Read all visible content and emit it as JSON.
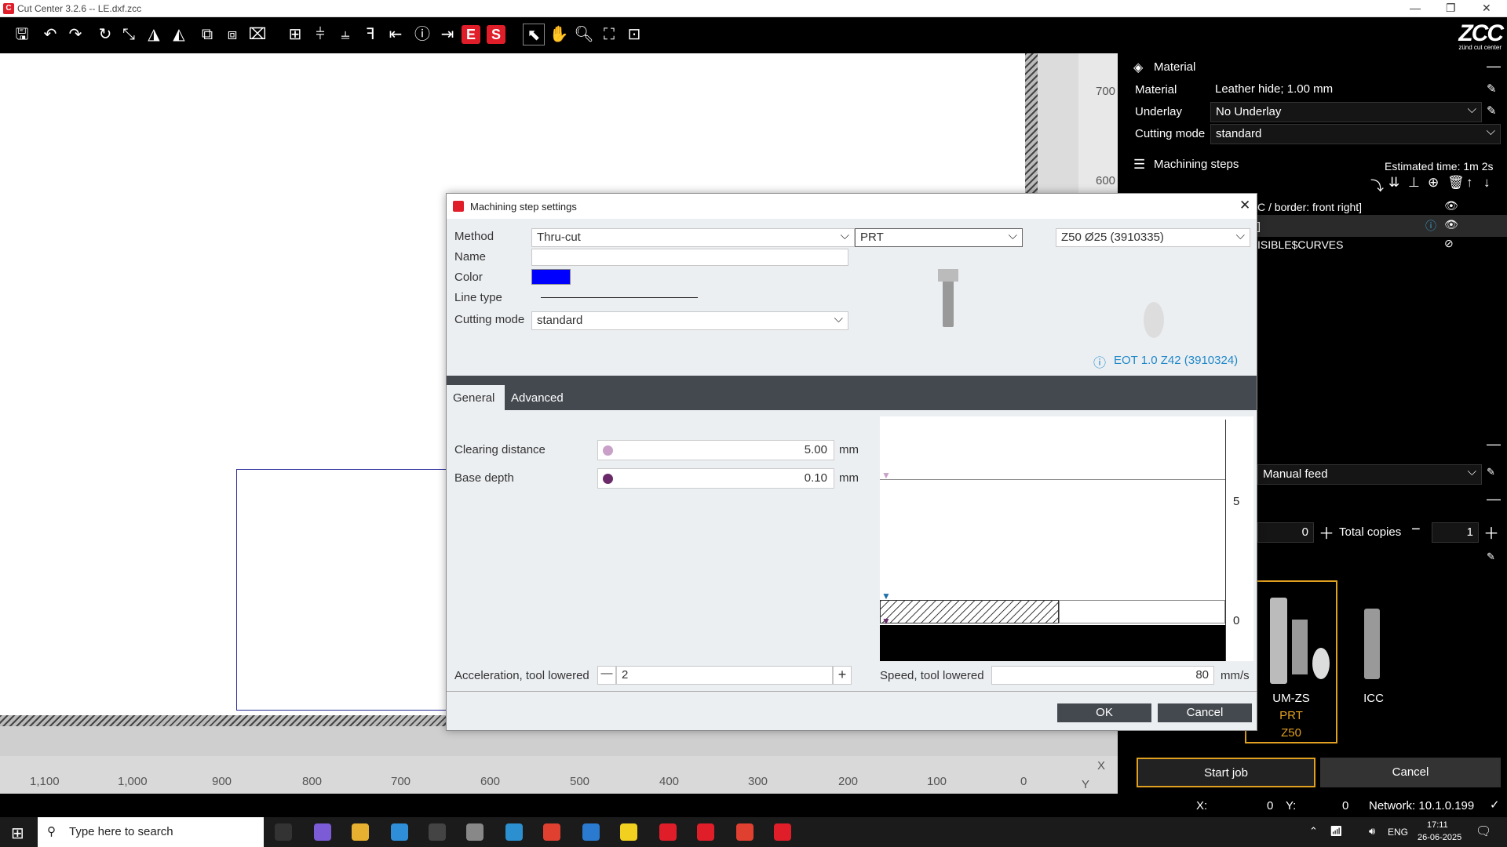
{
  "window": {
    "title": "Cut Center 3.2.6  --  LE.dxf.zcc"
  },
  "brand": {
    "logo": "ZCC",
    "tagline": "zünd cut center",
    "accent": "#e01e2a"
  },
  "toolbar": {
    "red1": "E",
    "red2": "S"
  },
  "canvas": {
    "vruler_ticks": [
      "700",
      "600"
    ],
    "hruler_ticks": [
      "1,100",
      "1,000",
      "900",
      "800",
      "700",
      "600",
      "500",
      "400",
      "300",
      "200",
      "100",
      "0"
    ],
    "x_axis": "X",
    "y_axis": "Y"
  },
  "panel": {
    "material_header": "Material",
    "material_label": "Material",
    "material_value": "Leather hide; 1.00 mm",
    "underlay_label": "Underlay",
    "underlay_value": "No Underlay",
    "cutting_mode_label": "Cutting mode",
    "cutting_mode_value": "standard",
    "steps_header": "Machining steps",
    "estimated": "Estimated time: 1m 2s",
    "step1": "C / border: front right]",
    "step2": "]",
    "step3": "ISIBLE$CURVES",
    "feed_value": "Manual feed",
    "copies_left": "0",
    "total_copies_label": "Total copies",
    "total_copies": "1",
    "tools": [
      {
        "name": "UM-ZS",
        "sub1": "PRT",
        "sub2": "Z50"
      },
      {
        "name": "ICC"
      }
    ],
    "start_job": "Start job",
    "cancel": "Cancel"
  },
  "status": {
    "x_label": "X:",
    "x_val": "0",
    "y_label": "Y:",
    "y_val": "0",
    "network": "Network: 10.1.0.199"
  },
  "taskbar": {
    "search_placeholder": "Type here to search",
    "lang": "ENG",
    "time": "17:11",
    "date": "26-06-2025"
  },
  "dialog": {
    "title": "Machining step settings",
    "method_label": "Method",
    "method_value": "Thru-cut",
    "name_label": "Name",
    "name_value": "",
    "color_label": "Color",
    "color_value": "#0000ff",
    "line_type_label": "Line type",
    "cutting_mode_label": "Cutting mode",
    "cutting_mode_value": "standard",
    "module": "PRT",
    "tool": "Z50 Ø25 (3910335)",
    "blade_info": "EOT 1.0 Z42 (3910324)",
    "tabs": [
      "General",
      "Advanced"
    ],
    "clearing_label": "Clearing distance",
    "clearing_value": "5.00",
    "clearing_unit": "mm",
    "base_label": "Base depth",
    "base_value": "0.10",
    "base_unit": "mm",
    "accel_label": "Acceleration, tool lowered",
    "accel_value": "2",
    "speed_label": "Speed, tool lowered",
    "speed_value": "80",
    "speed_unit": "mm/s",
    "depth_ticks": [
      "5",
      "0"
    ],
    "ok": "OK",
    "cancel": "Cancel"
  }
}
